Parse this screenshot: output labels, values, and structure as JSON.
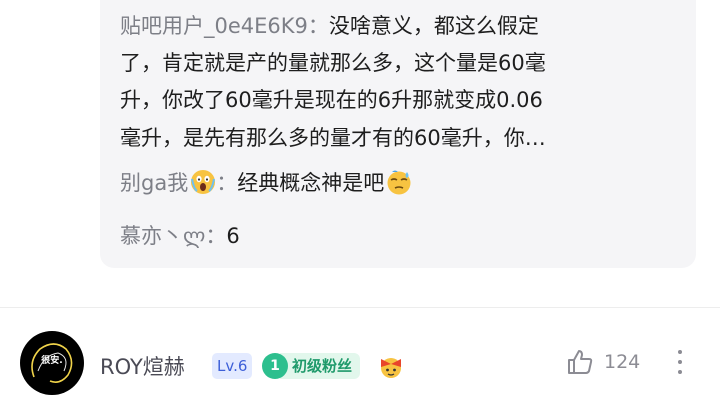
{
  "replies": {
    "reply1": {
      "user": "贴吧用户_0e4E6K9",
      "separator": "：",
      "lines": [
        "没啥意义，都这么假定",
        "了，肯定就是产的量就那么多，这个量是60毫",
        "升，你改了60毫升是现在的6升那就变成0.06",
        "毫升，是先有那么多的量才有的60毫升，你…"
      ]
    },
    "reply2": {
      "user": "别ga我",
      "user_emoji_icon": "screaming-face-icon",
      "separator": "：",
      "text": "经典概念神是吧",
      "text_emoji_icon": "sweat-face-icon"
    },
    "reply3": {
      "user": "慕亦丶ლ",
      "separator": "：",
      "text": "6"
    }
  },
  "comment": {
    "avatar_text": "很安.",
    "author": "ROY煊赫",
    "level_badge": "Lv.6",
    "fan_level": "1",
    "fan_badge": "初级粉丝",
    "extra_badge_icon": "ribbon-face-badge-icon",
    "like_count": "124"
  }
}
